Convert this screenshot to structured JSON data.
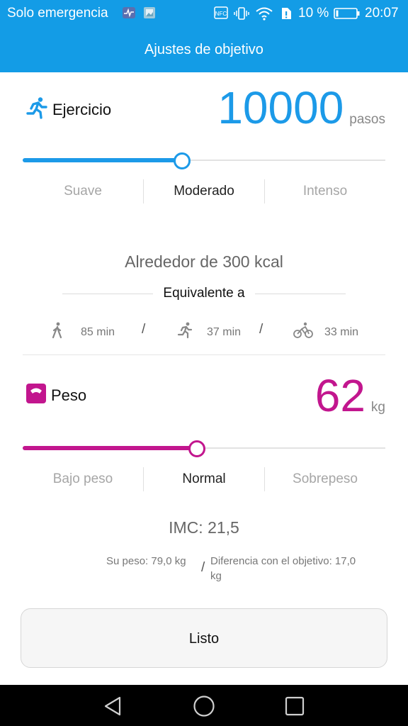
{
  "status_bar": {
    "carrier": "Solo emergencia",
    "battery_percent": "10 %",
    "time": "20:07",
    "color": "#139ce6"
  },
  "header": {
    "title": "Ajustes de objetivo"
  },
  "exercise": {
    "label": "Ejercicio",
    "icon": "running-icon",
    "value": "10000",
    "unit": "pasos",
    "accent_color": "#1c9ae8",
    "slider_fraction": 0.44,
    "levels": [
      "Suave",
      "Moderado",
      "Intenso"
    ],
    "selected_level": "Moderado",
    "calories": "Alrededor de 300 kcal",
    "equivalent_label": "Equivalente a",
    "activities": [
      {
        "icon": "walking-icon",
        "value": "85 min"
      },
      {
        "icon": "running-icon",
        "value": "37 min"
      },
      {
        "icon": "cycling-icon",
        "value": "33 min"
      }
    ],
    "separator": "/"
  },
  "weight": {
    "label": "Peso",
    "icon": "scale-icon",
    "value": "62",
    "unit": "kg",
    "accent_color": "#c2168e",
    "slider_fraction": 0.48,
    "levels": [
      "Bajo peso",
      "Normal",
      "Sobrepeso"
    ],
    "selected_level": "Normal",
    "bmi": "IMC: 21,5",
    "current_weight": "Su peso: 79,0 kg",
    "separator": "/",
    "difference_line1": "Diferencia con el objetivo: 17,0",
    "difference_line2": "kg"
  },
  "done_button": {
    "label": "Listo"
  },
  "nav_bar": {
    "buttons": [
      "back-icon",
      "home-icon",
      "recents-icon"
    ]
  }
}
